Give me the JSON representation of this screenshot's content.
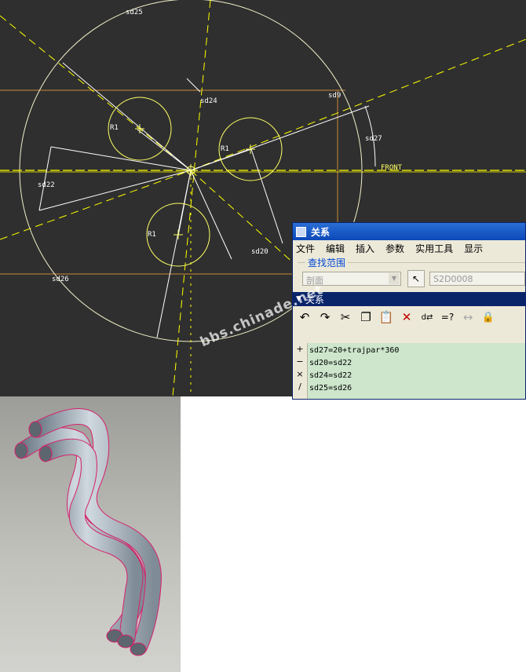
{
  "sketch": {
    "dimensions": [
      "sd25",
      "sd24",
      "sd9",
      "sd27",
      "sd22",
      "sd20",
      "sd26"
    ],
    "radius_labels": [
      "R1",
      "R1",
      "R1"
    ],
    "front_label": "FRONT"
  },
  "dialog": {
    "title": "关系",
    "menu": [
      "文件",
      "编辑",
      "插入",
      "参数",
      "实用工具",
      "显示"
    ],
    "find_scope": {
      "label": "查找范围",
      "select_value": "剖面",
      "value_field": "S2D0008"
    },
    "section_title": "关系",
    "operators": [
      "+",
      "−",
      "×",
      "/"
    ],
    "relations": [
      "sd27=20+trajpar*360",
      "sd20=sd22",
      "sd24=sd22",
      "sd25=sd26"
    ]
  },
  "watermark": "bbs.chinade.net"
}
